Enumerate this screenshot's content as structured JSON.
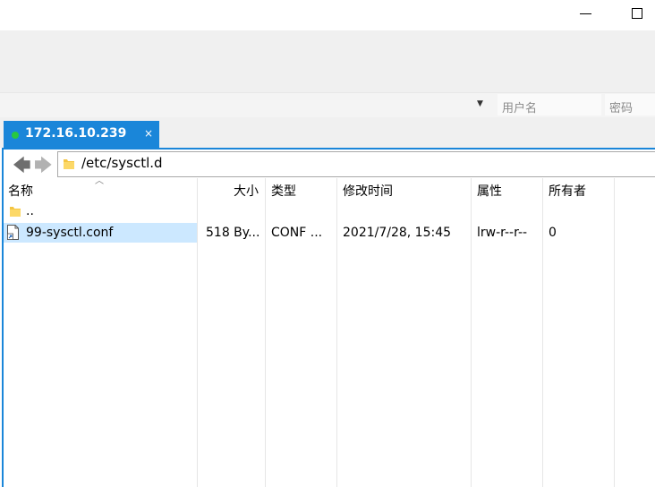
{
  "window": {
    "minimize_icon": "minimize-icon",
    "maximize_icon": "maximize-icon"
  },
  "quick_connect": {
    "dropdown_icon": "dropdown-arrow-icon",
    "username_placeholder": "用户名",
    "password_placeholder": "密码"
  },
  "tabs": [
    {
      "label": "172.16.10.239",
      "status_color": "#28c840",
      "close_label": "×",
      "active": true
    }
  ],
  "colors": {
    "accent": "#1a86d9",
    "selection": "#cce8ff",
    "folder": "#f4c542"
  },
  "address_bar": {
    "back_icon": "back-arrow-icon",
    "forward_icon": "forward-arrow-icon",
    "back_glyph": "🡄",
    "forward_glyph": "🡆",
    "path": "/etc/sysctl.d"
  },
  "file_list": {
    "columns": [
      "名称",
      "大小",
      "类型",
      "修改时间",
      "属性",
      "所有者"
    ],
    "sorted_column": "名称",
    "rows": [
      {
        "name": "..",
        "icon": "folder-icon",
        "size": "",
        "type": "",
        "modified": "",
        "perms": "",
        "owner": ""
      },
      {
        "name": "99-sysctl.conf",
        "icon": "file-link-icon",
        "size": "518 By...",
        "type": "CONF ...",
        "modified": "2021/7/28, 15:45",
        "perms": "lrw-r--r--",
        "owner": "0",
        "selected": true
      }
    ]
  }
}
